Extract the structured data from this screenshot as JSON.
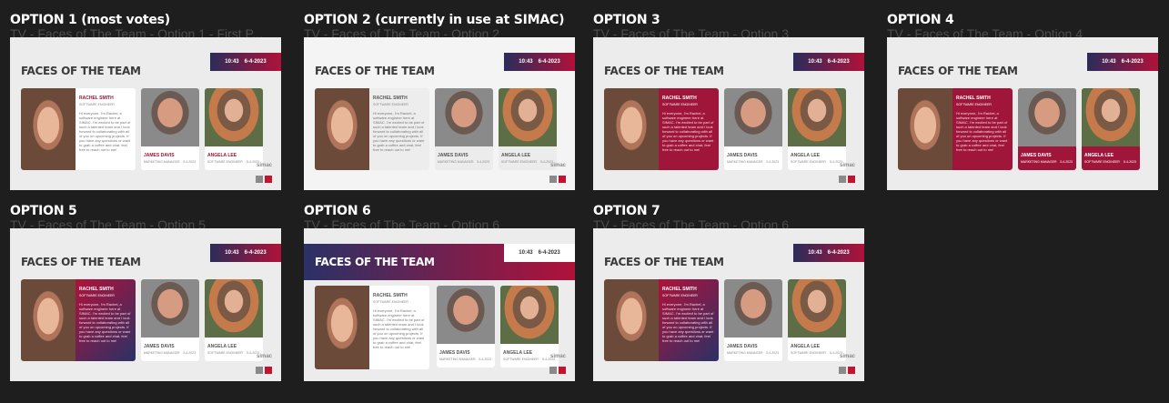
{
  "options": [
    {
      "title": "OPTION 1 (most votes)",
      "subtitle": "TV - Faces of The Team - Option 1 - First P...",
      "time": "10:43",
      "date": "6-4-2023",
      "heading": "FACES OF THE TEAM",
      "main_name": "RACHEL SMITH",
      "main_role": "SOFTWARE ENGINEER"
    },
    {
      "title": "OPTION 2 (currently in use at SIMAC)",
      "subtitle": "TV - Faces of The Team - Option 2",
      "time": "10:43",
      "date": "6-4-2023",
      "heading": "FACES OF THE TEAM",
      "main_name": "RACHEL SMITH",
      "main_role": "SOFTWARE ENGINEER"
    },
    {
      "title": "OPTION 3",
      "subtitle": "TV - Faces of The Team - Option 3",
      "time": "10:43",
      "date": "6-4-2023",
      "heading": "FACES OF THE TEAM",
      "main_name": "RACHEL SMITH",
      "main_role": "SOFTWARE ENGINEER"
    },
    {
      "title": "OPTION 4",
      "subtitle": "TV - Faces of The Team - Option 4",
      "time": "10:43",
      "date": "6-4-2023",
      "heading": "FACES OF THE TEAM",
      "main_name": "RACHEL SMITH",
      "main_role": "SOFTWARE ENGINEER"
    },
    {
      "title": "OPTION 5",
      "subtitle": "TV - Faces of The Team - Option 5",
      "time": "10:43",
      "date": "6-4-2023",
      "heading": "FACES OF THE TEAM",
      "main_name": "RACHEL SMITH",
      "main_role": "SOFTWARE ENGINEER"
    },
    {
      "title": "OPTION 6",
      "subtitle": "TV - Faces of The Team - Option 6",
      "time": "10:43",
      "date": "6-4-2023",
      "heading": "FACES OF THE TEAM",
      "main_name": "RACHEL SMITH",
      "main_role": "SOFTWARE ENGINEER"
    },
    {
      "title": "OPTION 7",
      "subtitle": "TV - Faces of The Team - Option 6",
      "time": "10:43",
      "date": "6-4-2023",
      "heading": "FACES OF THE TEAM",
      "main_name": "RACHEL SMITH",
      "main_role": "SOFTWARE ENGINEER"
    }
  ],
  "people": {
    "p2_name": "JAMES DAVIS",
    "p2_role": "MARKETING MANAGER",
    "p2_date": "3-4-2023",
    "p3_name": "ANGELA LEE",
    "p3_role": "SOFTWARE ENGINEER",
    "p3_date": "5-4-2023"
  },
  "bio": "Hi everyone, I'm Rachel, a software engineer here at SIMAC. I'm excited to be part of such a talented team and I look forward to collaborating with all of you on upcoming projects. If you have any questions or want to grab a coffee and chat, feel free to reach out to me!",
  "logo_text": "simac",
  "colors": {
    "accent": "#b0123a",
    "navy": "#2b2c5a",
    "background": "#1e1e1e"
  }
}
